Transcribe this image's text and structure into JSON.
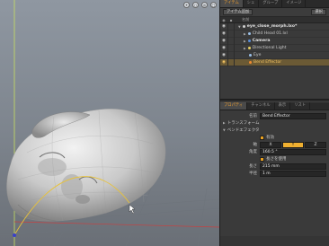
{
  "item_tabs": [
    "アイテム",
    "シェ",
    "グループ",
    "イメージ"
  ],
  "toolbar": {
    "add_item": "アイテム追加",
    "select": "選択"
  },
  "list_header": {
    "name": "名前"
  },
  "items": [
    {
      "label": "eye_close_morph.lxo*",
      "kind": "scene"
    },
    {
      "label": "Child Head 01.lxl",
      "kind": "mesh"
    },
    {
      "label": "Camera",
      "kind": "camera"
    },
    {
      "label": "Directional Light",
      "kind": "light"
    },
    {
      "label": "Eye",
      "kind": "mesh"
    },
    {
      "label": "Bend Effector",
      "kind": "effector",
      "selected": true
    }
  ],
  "prop_tabs": [
    "プロパティ",
    "チャンネル",
    "表示",
    "リスト"
  ],
  "properties": {
    "name_label": "名前",
    "name_value": "Bend Effector",
    "section_transform": "トランスフォーム",
    "section_bend": "ベンドエフェクタ",
    "enable_label": "有効",
    "axis_label": "軸",
    "axis_values": [
      "X",
      "Y",
      "Z"
    ],
    "axis_selected": "Y",
    "angle_label": "角度",
    "angle_value": "160.5 °",
    "use_length_label": "長さを使用",
    "length_label": "長さ",
    "length_value": "215 mm",
    "radius_label": "半径",
    "radius_value": "1 m"
  },
  "colors": {
    "accent": "#f0a030",
    "selected_row": "#6b5a35",
    "viewport": "#8a929c"
  },
  "icons": [
    "eye-icon",
    "camera-icon",
    "light-icon",
    "mesh-icon",
    "effector-icon",
    "checkbox-icon"
  ]
}
